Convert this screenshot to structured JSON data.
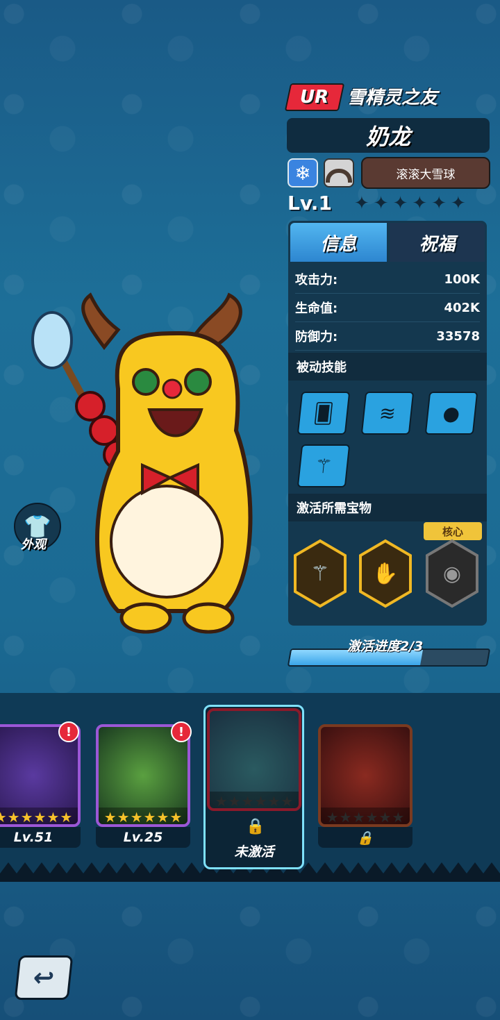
{
  "hero": {
    "rarity": "UR",
    "subtitle": "雪精灵之友",
    "name": "奶龙",
    "skill_name": "滚滚大雪球",
    "level": "Lv.1",
    "stars_total": 6,
    "stars_filled": 0
  },
  "tabs": {
    "info": "信息",
    "blessing": "祝福"
  },
  "stats": [
    {
      "label": "攻击力:",
      "value": "100K"
    },
    {
      "label": "生命值:",
      "value": "402K"
    },
    {
      "label": "防御力:",
      "value": "33578"
    }
  ],
  "sections": {
    "passive": "被动技能",
    "treasures": "激活所需宝物",
    "core": "核心"
  },
  "activation": {
    "label": "激活进度2/3",
    "progress": 0.667
  },
  "outfit": {
    "label": "外观"
  },
  "roster": [
    {
      "level": "Lv.51",
      "alert": "!",
      "locked": false
    },
    {
      "level": "Lv.25",
      "alert": "!",
      "locked": false
    },
    {
      "status": "未激活",
      "locked": true
    },
    {
      "locked": true
    }
  ],
  "colors": {
    "ur_red": "#e6283a",
    "panel_bg": "#14384f",
    "accent_blue": "#3aa5e8",
    "frame_purple": "#9b57d6"
  }
}
